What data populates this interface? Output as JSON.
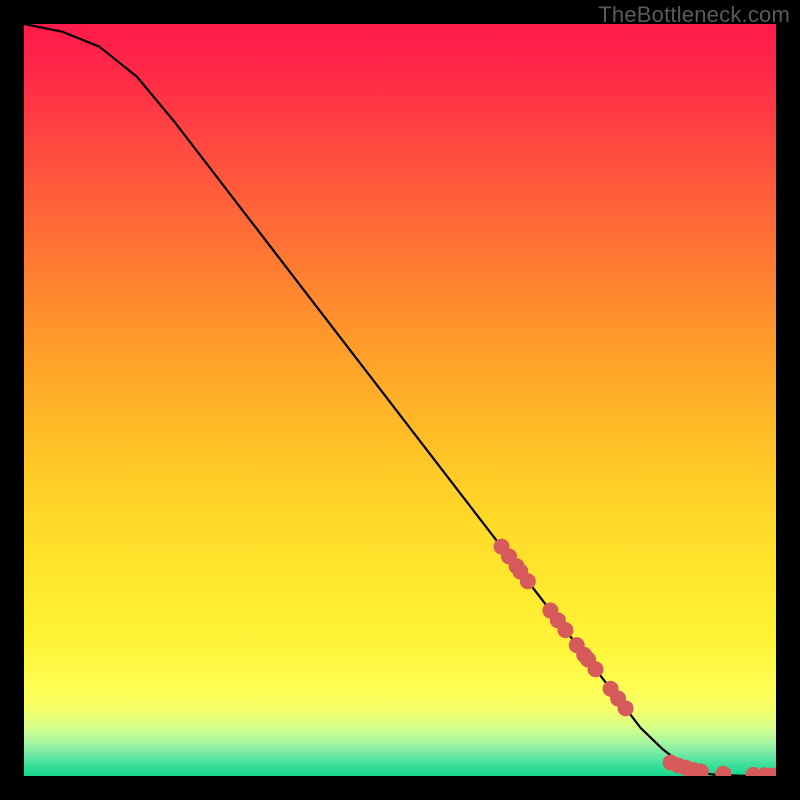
{
  "watermark": "TheBottleneck.com",
  "chart_data": {
    "type": "line",
    "title": "",
    "xlabel": "",
    "ylabel": "",
    "xlim": [
      0,
      100
    ],
    "ylim": [
      0,
      100
    ],
    "grid": false,
    "legend": null,
    "curve": {
      "name": "main-curve",
      "x": [
        0,
        5,
        10,
        15,
        20,
        25,
        30,
        35,
        40,
        45,
        50,
        55,
        60,
        65,
        70,
        75,
        80,
        82,
        85,
        88,
        90,
        92,
        95,
        100
      ],
      "y": [
        100,
        99,
        97,
        93,
        87,
        80.5,
        74,
        67.5,
        61,
        54.5,
        48,
        41.5,
        35,
        28.5,
        22,
        15.5,
        9,
        6.4,
        3.5,
        1.2,
        0.4,
        0.15,
        0.05,
        0.02
      ]
    },
    "markers": {
      "name": "highlight-points",
      "color": "#d65a5a",
      "x": [
        63.5,
        64.5,
        65.5,
        66,
        67,
        70,
        71,
        72,
        73.5,
        74.5,
        75,
        76,
        78,
        79,
        80,
        86,
        87,
        88,
        89,
        90,
        93,
        97,
        98.5,
        99.5
      ],
      "y": [
        30.5,
        29.2,
        27.9,
        27.2,
        25.9,
        22,
        20.7,
        19.4,
        17.4,
        16.1,
        15.5,
        14.2,
        11.6,
        10.3,
        9,
        1.8,
        1.4,
        1.1,
        0.8,
        0.6,
        0.3,
        0.15,
        0.1,
        0.05
      ]
    },
    "background_gradient": {
      "stops": [
        {
          "pos": 0.0,
          "color": "#ff1a4b"
        },
        {
          "pos": 0.07,
          "color": "#ff2a47"
        },
        {
          "pos": 0.18,
          "color": "#ff4f3f"
        },
        {
          "pos": 0.3,
          "color": "#ff7534"
        },
        {
          "pos": 0.42,
          "color": "#ff9a2a"
        },
        {
          "pos": 0.55,
          "color": "#ffbe26"
        },
        {
          "pos": 0.65,
          "color": "#ffd728"
        },
        {
          "pos": 0.75,
          "color": "#ffe92e"
        },
        {
          "pos": 0.83,
          "color": "#fff53a"
        },
        {
          "pos": 0.885,
          "color": "#fffe55"
        },
        {
          "pos": 0.912,
          "color": "#f4ff6a"
        },
        {
          "pos": 0.935,
          "color": "#d6ff88"
        },
        {
          "pos": 0.955,
          "color": "#a8f6a0"
        },
        {
          "pos": 0.972,
          "color": "#6fe9a5"
        },
        {
          "pos": 0.986,
          "color": "#3adf9a"
        },
        {
          "pos": 1.0,
          "color": "#17d68c"
        }
      ]
    }
  }
}
